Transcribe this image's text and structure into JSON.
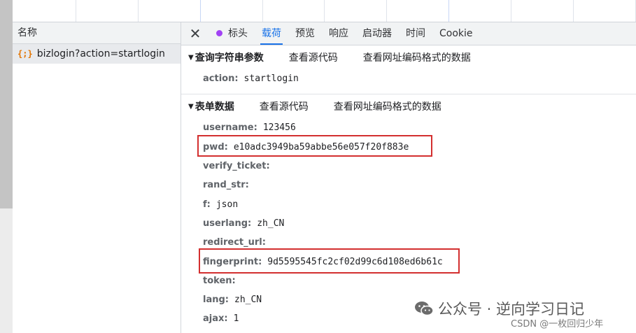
{
  "request_list": {
    "header": "名称",
    "rows": [
      {
        "icon": "{;}",
        "name": "bizlogin?action=startlogin"
      }
    ]
  },
  "tabs": [
    {
      "label": "标头"
    },
    {
      "label": "载荷"
    },
    {
      "label": "预览"
    },
    {
      "label": "响应"
    },
    {
      "label": "启动器"
    },
    {
      "label": "时间"
    },
    {
      "label": "Cookie"
    }
  ],
  "active_tab": "载荷",
  "query_section": {
    "title": "查询字符串参数",
    "view_source": "查看源代码",
    "view_url_encoded": "查看网址编码格式的数据",
    "params": [
      {
        "key": "action:",
        "value": "startlogin"
      }
    ]
  },
  "form_section": {
    "title": "表单数据",
    "view_source": "查看源代码",
    "view_url_encoded": "查看网址编码格式的数据",
    "params": [
      {
        "key": "username:",
        "value": "123456"
      },
      {
        "key": "pwd:",
        "value": "e10adc3949ba59abbe56e057f20f883e"
      },
      {
        "key": "verify_ticket:",
        "value": ""
      },
      {
        "key": "rand_str:",
        "value": ""
      },
      {
        "key": "f:",
        "value": "json"
      },
      {
        "key": "userlang:",
        "value": "zh_CN"
      },
      {
        "key": "redirect_url:",
        "value": ""
      },
      {
        "key": "fingerprint:",
        "value": "9d5595545fc2cf02d99c6d108ed6b61c"
      },
      {
        "key": "token:",
        "value": ""
      },
      {
        "key": "lang:",
        "value": "zh_CN"
      },
      {
        "key": "ajax:",
        "value": "1"
      }
    ]
  },
  "colors": {
    "accent": "#1a73e8",
    "highlight_box": "#d32f2f",
    "headers_dot": "#a142f4",
    "xhr_icon": "#e37400"
  },
  "watermark": {
    "line1": "公众号 · 逆向学习日记",
    "line2": "CSDN @一枚回归少年"
  }
}
